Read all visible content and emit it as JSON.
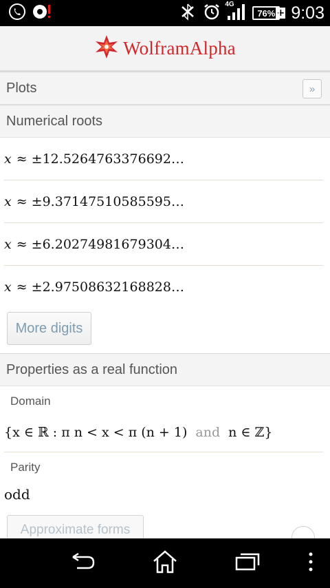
{
  "status_bar": {
    "time": "9:03",
    "battery": "76%",
    "network": "4G",
    "icons": [
      "whatsapp-icon",
      "notification-icon",
      "bluetooth-icon",
      "alarm-icon",
      "signal-icon",
      "battery-icon"
    ]
  },
  "header": {
    "brand": "WolframAlpha"
  },
  "plots": {
    "title": "Plots",
    "expand_label": "»"
  },
  "numerical_roots": {
    "title": "Numerical roots",
    "variable": "x",
    "rows": [
      {
        "value": "≈ ±12.5264763376692…"
      },
      {
        "value": "≈ ±9.37147510585595…"
      },
      {
        "value": "≈ ±6.20274981679304…"
      },
      {
        "value": "≈ ±2.97508632168828…"
      }
    ],
    "more_digits": "More digits"
  },
  "properties": {
    "title": "Properties as a real function",
    "domain_label": "Domain",
    "domain_part1": "{x ∈ ℝ : π n < x < π (n + 1)",
    "domain_and": "and",
    "domain_part2": "n ∈ ℤ}",
    "parity_label": "Parity",
    "parity_value": "odd",
    "approx_button": "Approximate forms"
  },
  "colors": {
    "brand": "#d2262a",
    "link": "#7e9cb0"
  }
}
